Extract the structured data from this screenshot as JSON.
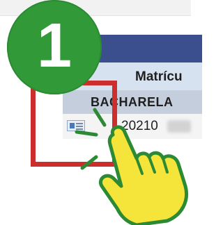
{
  "step": {
    "number": "1"
  },
  "table": {
    "column_header": "Matrícu",
    "group_label": "BACHARELA",
    "row_value": "20210"
  },
  "colors": {
    "badge": "#329939",
    "highlight": "#cc2e2e",
    "header_bar": "#3b4f8e",
    "hand_fill": "#f5e43a",
    "hand_outline": "#2d8a34"
  },
  "icons": {
    "row_icon": "id-card-icon",
    "pointer": "pointing-hand-icon"
  }
}
